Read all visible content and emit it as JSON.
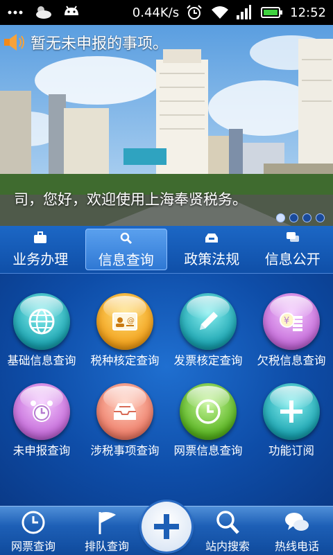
{
  "status_bar": {
    "speed": "0.44K/s",
    "time": "12:52",
    "icons": [
      "cloud-icon",
      "android-icon",
      "alarm-icon",
      "wifi-icon",
      "signal-icon",
      "battery-icon"
    ]
  },
  "banner": {
    "notice": "暂无未申报的事项。",
    "welcome": "司，您好，欢迎使用上海奉贤税务。",
    "slides": 4,
    "active_slide": 1
  },
  "tabs": [
    {
      "label": "业务办理",
      "icon": "briefcase-icon"
    },
    {
      "label": "信息查询",
      "icon": "search-icon",
      "active": true
    },
    {
      "label": "政策法规",
      "icon": "inbox-icon"
    },
    {
      "label": "信息公开",
      "icon": "chat-icon"
    }
  ],
  "grid": [
    {
      "label": "基础信息查询",
      "icon": "globe-icon",
      "color": "#1aa3b0"
    },
    {
      "label": "税种核定查询",
      "icon": "contact-card-icon",
      "color": "#f2a01a"
    },
    {
      "label": "发票核定查询",
      "icon": "pencil-icon",
      "color": "#1aa3b0"
    },
    {
      "label": "欠税信息查询",
      "icon": "coin-stack-icon",
      "color": "#c46ad8"
    },
    {
      "label": "未申报查询",
      "icon": "alarm-clock-icon",
      "color": "#c46ad8"
    },
    {
      "label": "涉税事项查询",
      "icon": "tray-icon",
      "color": "#ee7d68"
    },
    {
      "label": "网票信息查询",
      "icon": "clock-icon",
      "color": "#58b420"
    },
    {
      "label": "功能订阅",
      "icon": "plus-icon",
      "color": "#1aa3b0"
    }
  ],
  "bottom_nav": {
    "items": [
      {
        "label": "网票查询",
        "icon": "clock-icon"
      },
      {
        "label": "排队查询",
        "icon": "flag-icon"
      },
      {
        "label": "站内搜索",
        "icon": "search-icon"
      },
      {
        "label": "热线电话",
        "icon": "chat-bubbles-icon"
      }
    ],
    "center_icon": "plus-icon"
  }
}
